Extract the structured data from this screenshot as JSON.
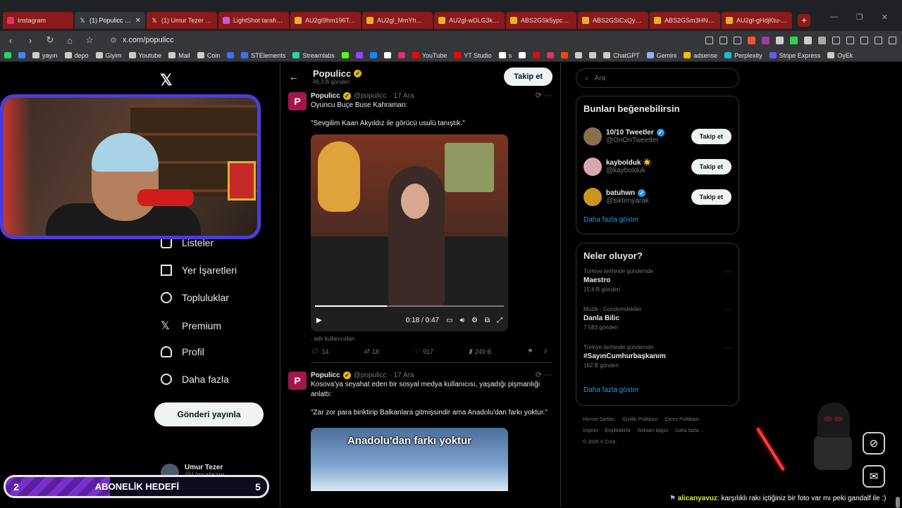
{
  "browser": {
    "tabs": [
      {
        "label": "Instagram",
        "color": "#e1306c",
        "icon": "instagram-icon",
        "active": false,
        "closable": false
      },
      {
        "label": "(1) Populicc (@p",
        "color": "#ffffff",
        "icon": "x-icon",
        "active": true,
        "closable": true
      },
      {
        "label": "(1) Umur Tezer (@U",
        "color": "#ffffff",
        "icon": "x-icon",
        "active": false,
        "closable": false
      },
      {
        "label": "LightShot tarafında",
        "color": "#c65be0",
        "icon": "feather-icon",
        "active": false,
        "closable": false
      },
      {
        "label": "AU2gI9hm196Ts5b",
        "color": "#e8b41f",
        "icon": "star-icon",
        "active": false,
        "closable": false
      },
      {
        "label": "AU2gl_MmYhWxzL",
        "color": "#e8b41f",
        "icon": "star-icon",
        "active": false,
        "closable": false
      },
      {
        "label": "AU2gl-wDLG3kKpf",
        "color": "#e8b41f",
        "icon": "star-icon",
        "active": false,
        "closable": false
      },
      {
        "label": "ABS2GSk5ypc19uv",
        "color": "#e8b41f",
        "icon": "star-icon",
        "active": false,
        "closable": false
      },
      {
        "label": "ABS2GSiCxQyYJU3",
        "color": "#e8b41f",
        "icon": "star-icon",
        "active": false,
        "closable": false
      },
      {
        "label": "ABS2GSm3HN2pfj",
        "color": "#e8b41f",
        "icon": "star-icon",
        "active": false,
        "closable": false
      },
      {
        "label": "AU2gI-gHdjKtu-d_U",
        "color": "#e8b41f",
        "icon": "star-icon",
        "active": false,
        "closable": false
      }
    ],
    "new_tab": "+",
    "url": "x.com/populicc",
    "bookmarks": [
      {
        "label": "",
        "color": "#25d366"
      },
      {
        "label": "",
        "color": "#4285f4"
      },
      {
        "label": "yayın",
        "color": "#cccccc"
      },
      {
        "label": "depo",
        "color": "#cccccc"
      },
      {
        "label": "Giyim",
        "color": "#cccccc"
      },
      {
        "label": "Youtube",
        "color": "#cccccc"
      },
      {
        "label": "Mail",
        "color": "#cccccc"
      },
      {
        "label": "Coin",
        "color": "#cccccc"
      },
      {
        "label": "",
        "color": "#3b6ff5"
      },
      {
        "label": "STElements",
        "color": "#3b6ff5"
      },
      {
        "label": "Streamlabs",
        "color": "#2bd4a0"
      },
      {
        "label": "",
        "color": "#53fc18"
      },
      {
        "label": "",
        "color": "#9146ff"
      },
      {
        "label": "",
        "color": "#1185fe"
      },
      {
        "label": "",
        "color": "#ffffff"
      },
      {
        "label": "",
        "color": "#e1306c"
      },
      {
        "label": "YouTube",
        "color": "#ff0000"
      },
      {
        "label": "YT Studio",
        "color": "#ff0000"
      },
      {
        "label": "s",
        "color": "#ffffff"
      },
      {
        "label": "",
        "color": "#ffffff"
      },
      {
        "label": "",
        "color": "#e50914"
      },
      {
        "label": "",
        "color": "#e1306c"
      },
      {
        "label": "",
        "color": "#ff4500"
      },
      {
        "label": "",
        "color": "#cccccc"
      },
      {
        "label": "",
        "color": "#cccccc"
      },
      {
        "label": "ChatGPT",
        "color": "#cccccc"
      },
      {
        "label": "Gemini",
        "color": "#8ab4f8"
      },
      {
        "label": "adsense",
        "color": "#fbbc04"
      },
      {
        "label": "Perplexity",
        "color": "#20b8cd"
      },
      {
        "label": "Stripe Express",
        "color": "#635bff"
      },
      {
        "label": "OyEk",
        "color": "#cccccc"
      }
    ]
  },
  "nav": {
    "items": [
      "Listeler",
      "Yer İşaretleri",
      "Topluluklar",
      "Premium",
      "Profil",
      "Daha fazla"
    ],
    "post_button": "Gönderi yayınla",
    "me_name": "Umur Tezer",
    "me_handle": "@Umurtezer"
  },
  "profile": {
    "name": "Populicc",
    "count": "46,3 B gönderi",
    "follow": "Takip et"
  },
  "tweets": [
    {
      "name": "Populicc",
      "handle": "@populicc",
      "date": "· 17 Ara",
      "line1": "Oyuncu Buçe Buse Kahraman:",
      "line2": "\"Sevgilim Kaan Akyıldız ile görücü usulü tanıştık.\"",
      "video_time": "0:18 / 0:47",
      "video_progress": 0.38,
      "source": ". adlı kullanıcıdan",
      "replies": "14",
      "reposts": "18",
      "likes": "917",
      "views": "249 B"
    },
    {
      "name": "Populicc",
      "handle": "@populicc",
      "date": "· 17 Ara",
      "line1": "Kosova'ya seyahat eden bir sosyal medya kullanıcısı, yaşadığı pişmanlığı anlattı:",
      "line2": "\"Zar zor para biriktirip Balkanlara gitmişsindir ama Anadolu'dan farkı yoktur.\"",
      "video_caption": "Anadolu'dan farkı yoktur"
    }
  ],
  "right": {
    "search_placeholder": "Ara",
    "suggest_title": "Bunları beğenebilirsin",
    "suggestions": [
      {
        "name": "10/10 Tweetler",
        "handle": "@OnOnTweetler",
        "verified": true,
        "avatar_color": "#8a6d4a"
      },
      {
        "name": "kaybolduk ☀️",
        "handle": "@kayboIduk",
        "verified": false,
        "avatar_color": "#d9a7b3"
      },
      {
        "name": "batuhwn",
        "handle": "@siktenyarak",
        "verified": true,
        "avatar_color": "#c9951e"
      }
    ],
    "follow": "Takip et",
    "show_more": "Daha fazla göster",
    "trends_title": "Neler oluyor?",
    "trends": [
      {
        "context": "Türkiye tarihinde gündemde",
        "title": "Maestro",
        "posts": "15,6 B gönderi"
      },
      {
        "context": "Müzik · Gündemdekiler",
        "title": "Danla Bilic",
        "posts": "7.583 gönderi"
      },
      {
        "context": "Türkiye tarihinde gündemde",
        "title": "#SayınCumhurbaşkanım",
        "posts": "162 B gönderi"
      }
    ],
    "footer": [
      "Hizmet Şartları",
      "Gizlilik Politikası",
      "Çerez Politikası",
      "Imprint",
      "Erişilebilirlik",
      "Reklam bilgisi",
      "Daha fazla ...",
      "© 2025 X Corp."
    ]
  },
  "overlay": {
    "goal_current": "2",
    "goal_label": "ABONELİK HEDEFİ",
    "goal_target": "5",
    "goal_fraction": 0.4,
    "chat_user": "alicanyavuz",
    "chat_message": ": karşılıklı rakı içtiğiniz bir foto var mı peki gandalf ile :)"
  },
  "colors": {
    "accent_link": "#1d9bf0",
    "tab_red": "#8b1a1a",
    "goal_purple": "#7a30c9",
    "webcam_border": "#4c3ddb"
  }
}
